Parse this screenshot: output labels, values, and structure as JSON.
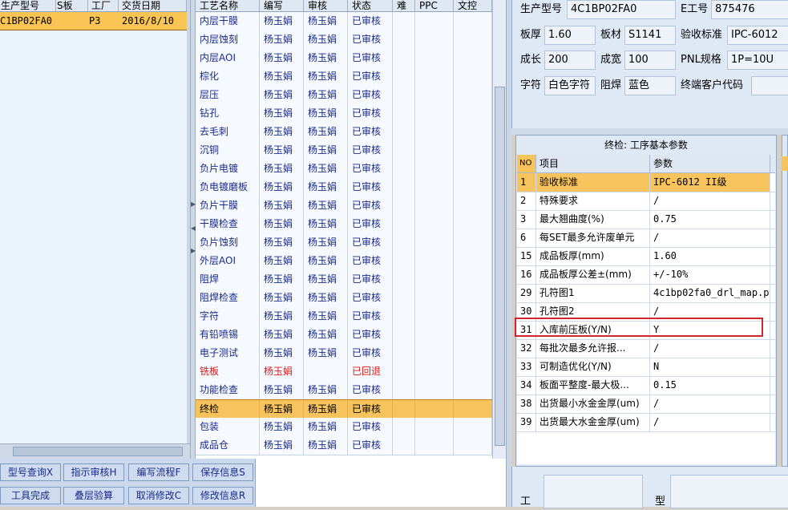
{
  "left_grid": {
    "headers": [
      "生产型号",
      "S板",
      "工厂",
      "交货日期"
    ],
    "row": {
      "model": "C1BP02FA0",
      "factory": "P3",
      "date": "2016/8/10"
    }
  },
  "process_grid": {
    "headers": [
      "工艺名称",
      "编写",
      "审核",
      "状态",
      "难",
      "PPC",
      "文控"
    ],
    "rows": [
      {
        "name": "内层干膜",
        "writer": "杨玉娟",
        "reviewer": "杨玉娟",
        "status": "已审核"
      },
      {
        "name": "内层蚀刻",
        "writer": "杨玉娟",
        "reviewer": "杨玉娟",
        "status": "已审核"
      },
      {
        "name": "内层AOI",
        "writer": "杨玉娟",
        "reviewer": "杨玉娟",
        "status": "已审核"
      },
      {
        "name": "棕化",
        "writer": "杨玉娟",
        "reviewer": "杨玉娟",
        "status": "已审核"
      },
      {
        "name": "层压",
        "writer": "杨玉娟",
        "reviewer": "杨玉娟",
        "status": "已审核"
      },
      {
        "name": "钻孔",
        "writer": "杨玉娟",
        "reviewer": "杨玉娟",
        "status": "已审核"
      },
      {
        "name": "去毛刺",
        "writer": "杨玉娟",
        "reviewer": "杨玉娟",
        "status": "已审核"
      },
      {
        "name": "沉铜",
        "writer": "杨玉娟",
        "reviewer": "杨玉娟",
        "status": "已审核"
      },
      {
        "name": "负片电镀",
        "writer": "杨玉娟",
        "reviewer": "杨玉娟",
        "status": "已审核"
      },
      {
        "name": "负电镀磨板",
        "writer": "杨玉娟",
        "reviewer": "杨玉娟",
        "status": "已审核"
      },
      {
        "name": "负片干膜",
        "writer": "杨玉娟",
        "reviewer": "杨玉娟",
        "status": "已审核"
      },
      {
        "name": "干膜检查",
        "writer": "杨玉娟",
        "reviewer": "杨玉娟",
        "status": "已审核"
      },
      {
        "name": "负片蚀刻",
        "writer": "杨玉娟",
        "reviewer": "杨玉娟",
        "status": "已审核"
      },
      {
        "name": "外层AOI",
        "writer": "杨玉娟",
        "reviewer": "杨玉娟",
        "status": "已审核"
      },
      {
        "name": "阻焊",
        "writer": "杨玉娟",
        "reviewer": "杨玉娟",
        "status": "已审核"
      },
      {
        "name": "阻焊检查",
        "writer": "杨玉娟",
        "reviewer": "杨玉娟",
        "status": "已审核"
      },
      {
        "name": "字符",
        "writer": "杨玉娟",
        "reviewer": "杨玉娟",
        "status": "已审核"
      },
      {
        "name": "有铅喷锡",
        "writer": "杨玉娟",
        "reviewer": "杨玉娟",
        "status": "已审核"
      },
      {
        "name": "电子测试",
        "writer": "杨玉娟",
        "reviewer": "杨玉娟",
        "status": "已审核"
      },
      {
        "name": "铣板",
        "writer": "杨玉娟",
        "reviewer": "",
        "status": "已回退"
      },
      {
        "name": "功能检查",
        "writer": "杨玉娟",
        "reviewer": "杨玉娟",
        "status": "已审核"
      },
      {
        "name": "终检",
        "writer": "杨玉娟",
        "reviewer": "杨玉娟",
        "status": "已审核"
      },
      {
        "name": "包装",
        "writer": "杨玉娟",
        "reviewer": "杨玉娟",
        "status": "已审核"
      },
      {
        "name": "成品仓",
        "writer": "杨玉娟",
        "reviewer": "杨玉娟",
        "status": "已审核"
      }
    ],
    "selected_index": 21,
    "rejected_index": 19,
    "rejected_color": "#e01818",
    "selected_color": "#f7c35c"
  },
  "buttons": [
    "型号查询X",
    "指示审核H",
    "编写流程F",
    "保存信息S",
    "工具完成",
    "叠层验算",
    "取消修改C",
    "修改信息R"
  ],
  "info_form": {
    "model_label": "生产型号",
    "model_value": "4C1BP02FA0",
    "eno_label": "E工号",
    "eno_value": "875476",
    "thick_label": "板厚",
    "thick_value": "1.60",
    "material_label": "板材",
    "material_value": "S1141",
    "std_label": "验收标准",
    "std_value": "IPC-6012",
    "len_label": "成长",
    "len_value": "200",
    "width_label": "成宽",
    "width_value": "100",
    "pnl_label": "PNL规格",
    "pnl_value": "1P=10U",
    "char_label": "字符",
    "char_value": "白色字符",
    "mask_label": "阻焊",
    "mask_value": "蓝色",
    "cust_label": "终端客户代码",
    "cust_value": ""
  },
  "param_panel": {
    "title": "终检: 工序基本参数",
    "headers": [
      "NO",
      "项目",
      "参数"
    ],
    "rows": [
      {
        "no": "1",
        "item": "验收标准",
        "value": "IPC-6012 II级"
      },
      {
        "no": "2",
        "item": "特殊要求",
        "value": "/"
      },
      {
        "no": "3",
        "item": "最大翘曲度(%)",
        "value": "0.75"
      },
      {
        "no": "6",
        "item": "每SET最多允许废单元",
        "value": "/"
      },
      {
        "no": "15",
        "item": "成品板厚(mm)",
        "value": "1.60"
      },
      {
        "no": "16",
        "item": "成品板厚公差±(mm)",
        "value": "+/-10%"
      },
      {
        "no": "29",
        "item": "孔符图1",
        "value": "4c1bp02fa0_drl_map.p"
      },
      {
        "no": "30",
        "item": "孔符图2",
        "value": "/"
      },
      {
        "no": "31",
        "item": "入库前压板(Y/N)",
        "value": "Y"
      },
      {
        "no": "32",
        "item": "每批次最多允许报...",
        "value": "/"
      },
      {
        "no": "33",
        "item": "可制造优化(Y/N)",
        "value": "N"
      },
      {
        "no": "34",
        "item": "板面平整度-最大极...",
        "value": "0.15"
      },
      {
        "no": "38",
        "item": "出货最小水金金厚(um)",
        "value": "/"
      },
      {
        "no": "39",
        "item": "出货最大水金金厚(um)",
        "value": "/"
      }
    ],
    "highlight_color": "#d2262e"
  },
  "bottom_labels": {
    "l1": "工",
    "l2": "型"
  }
}
